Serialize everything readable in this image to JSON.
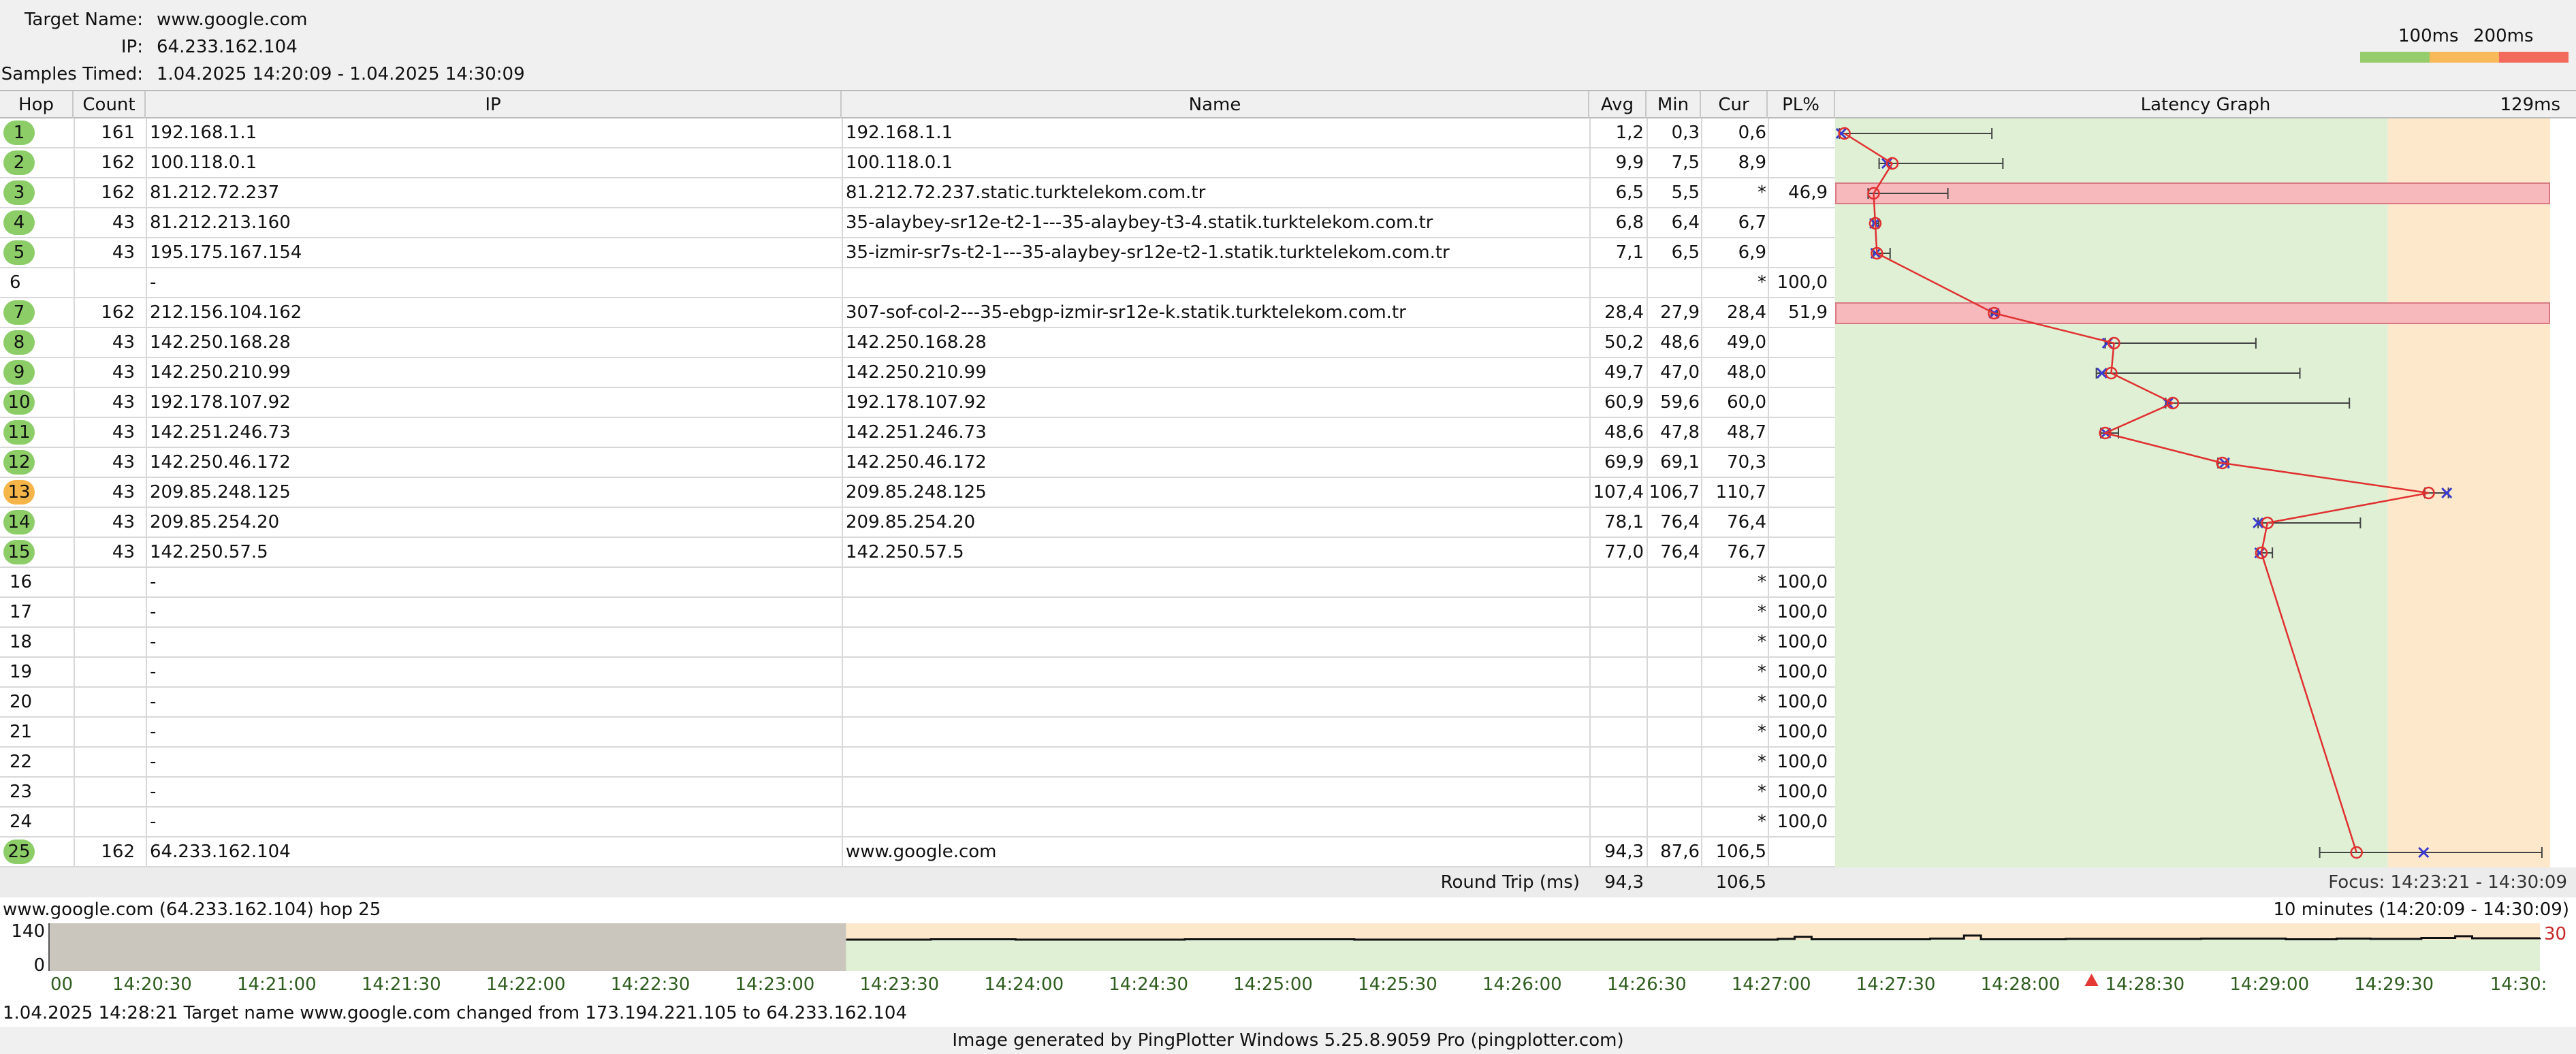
{
  "header": {
    "target_label": "Target Name:",
    "target_value": "www.google.com",
    "ip_label": "IP:",
    "ip_value": "64.233.162.104",
    "samples_label": "Samples Timed:",
    "samples_value": "1.04.2025 14:20:09 - 1.04.2025 14:30:09",
    "legend_100": "100ms",
    "legend_200": "200ms"
  },
  "colors": {
    "good": "#95cc6c",
    "warn": "#f7b95a",
    "bad": "#f16a5c",
    "graph_green": "#dff0d5",
    "graph_orange": "#fde8cb",
    "loss_fill": "#f8b9bd",
    "line": "#e03030",
    "marker": "#3a3ad0",
    "hop_green": "#8ccd68",
    "hop_orange": "#f5b549"
  },
  "columns": {
    "hop": "Hop",
    "count": "Count",
    "ip": "IP",
    "name": "Name",
    "avg": "Avg",
    "min": "Min",
    "cur": "Cur",
    "pl": "PL%",
    "graph": "Latency Graph",
    "graph_max": "129ms"
  },
  "hops": [
    {
      "hop": "1",
      "count": "161",
      "ip": "192.168.1.1",
      "name": "192.168.1.1",
      "avg": "1,2",
      "min": "0,3",
      "cur": "0,6",
      "pl": "",
      "status": "good",
      "avg_ms": 1.2,
      "min_ms": 0.3,
      "cur_ms": 0.6,
      "max_ms": 28
    },
    {
      "hop": "2",
      "count": "162",
      "ip": "100.118.0.1",
      "name": "100.118.0.1",
      "avg": "9,9",
      "min": "7,5",
      "cur": "8,9",
      "pl": "",
      "status": "good",
      "avg_ms": 9.9,
      "min_ms": 7.5,
      "cur_ms": 8.9,
      "max_ms": 30
    },
    {
      "hop": "3",
      "count": "162",
      "ip": "81.212.72.237",
      "name": "81.212.72.237.static.turktelekom.com.tr",
      "avg": "6,5",
      "min": "5,5",
      "cur": "*",
      "pl": "46,9",
      "status": "good",
      "avg_ms": 6.5,
      "min_ms": 5.5,
      "cur_ms": null,
      "max_ms": 20,
      "loss": true
    },
    {
      "hop": "4",
      "count": "43",
      "ip": "81.212.213.160",
      "name": "35-alaybey-sr12e-t2-1---35-alaybey-t3-4.statik.turktelekom.com.tr",
      "avg": "6,8",
      "min": "6,4",
      "cur": "6,7",
      "pl": "",
      "status": "good",
      "avg_ms": 6.8,
      "min_ms": 6.4,
      "cur_ms": 6.7,
      "max_ms": 7.4
    },
    {
      "hop": "5",
      "count": "43",
      "ip": "195.175.167.154",
      "name": "35-izmir-sr7s-t2-1---35-alaybey-sr12e-t2-1.statik.turktelekom.com.tr",
      "avg": "7,1",
      "min": "6,5",
      "cur": "6,9",
      "pl": "",
      "status": "good",
      "avg_ms": 7.1,
      "min_ms": 6.5,
      "cur_ms": 6.9,
      "max_ms": 9.5
    },
    {
      "hop": "6",
      "count": "",
      "ip": "-",
      "name": "",
      "avg": "",
      "min": "",
      "cur": "*",
      "pl": "100,0",
      "status": "none"
    },
    {
      "hop": "7",
      "count": "162",
      "ip": "212.156.104.162",
      "name": "307-sof-col-2---35-ebgp-izmir-sr12e-k.statik.turktelekom.com.tr",
      "avg": "28,4",
      "min": "27,9",
      "cur": "28,4",
      "pl": "51,9",
      "status": "good",
      "avg_ms": 28.4,
      "min_ms": 27.9,
      "cur_ms": 28.4,
      "max_ms": 29,
      "loss": true
    },
    {
      "hop": "8",
      "count": "43",
      "ip": "142.250.168.28",
      "name": "142.250.168.28",
      "avg": "50,2",
      "min": "48,6",
      "cur": "49,0",
      "pl": "",
      "status": "good",
      "avg_ms": 50.2,
      "min_ms": 48.6,
      "cur_ms": 49.0,
      "max_ms": 76
    },
    {
      "hop": "9",
      "count": "43",
      "ip": "142.250.210.99",
      "name": "142.250.210.99",
      "avg": "49,7",
      "min": "47,0",
      "cur": "48,0",
      "pl": "",
      "status": "good",
      "avg_ms": 49.7,
      "min_ms": 47.0,
      "cur_ms": 48.0,
      "max_ms": 84
    },
    {
      "hop": "10",
      "count": "43",
      "ip": "192.178.107.92",
      "name": "192.178.107.92",
      "avg": "60,9",
      "min": "59,6",
      "cur": "60,0",
      "pl": "",
      "status": "good",
      "avg_ms": 60.9,
      "min_ms": 59.6,
      "cur_ms": 60.0,
      "max_ms": 93
    },
    {
      "hop": "11",
      "count": "43",
      "ip": "142.251.246.73",
      "name": "142.251.246.73",
      "avg": "48,6",
      "min": "47,8",
      "cur": "48,7",
      "pl": "",
      "status": "good",
      "avg_ms": 48.6,
      "min_ms": 47.8,
      "cur_ms": 48.7,
      "max_ms": 51
    },
    {
      "hop": "12",
      "count": "43",
      "ip": "142.250.46.172",
      "name": "142.250.46.172",
      "avg": "69,9",
      "min": "69,1",
      "cur": "70,3",
      "pl": "",
      "status": "good",
      "avg_ms": 69.9,
      "min_ms": 69.1,
      "cur_ms": 70.3,
      "max_ms": 71
    },
    {
      "hop": "13",
      "count": "43",
      "ip": "209.85.248.125",
      "name": "209.85.248.125",
      "avg": "107,4",
      "min": "106,7",
      "cur": "110,7",
      "pl": "",
      "status": "warn",
      "avg_ms": 107.4,
      "min_ms": 106.7,
      "cur_ms": 110.7,
      "max_ms": 111
    },
    {
      "hop": "14",
      "count": "43",
      "ip": "209.85.254.20",
      "name": "209.85.254.20",
      "avg": "78,1",
      "min": "76,4",
      "cur": "76,4",
      "pl": "",
      "status": "good",
      "avg_ms": 78.1,
      "min_ms": 76.4,
      "cur_ms": 76.4,
      "max_ms": 95
    },
    {
      "hop": "15",
      "count": "43",
      "ip": "142.250.57.5",
      "name": "142.250.57.5",
      "avg": "77,0",
      "min": "76,4",
      "cur": "76,7",
      "pl": "",
      "status": "good",
      "avg_ms": 77.0,
      "min_ms": 76.4,
      "cur_ms": 76.7,
      "max_ms": 79
    },
    {
      "hop": "16",
      "count": "",
      "ip": "-",
      "name": "",
      "avg": "",
      "min": "",
      "cur": "*",
      "pl": "100,0",
      "status": "none"
    },
    {
      "hop": "17",
      "count": "",
      "ip": "-",
      "name": "",
      "avg": "",
      "min": "",
      "cur": "*",
      "pl": "100,0",
      "status": "none"
    },
    {
      "hop": "18",
      "count": "",
      "ip": "-",
      "name": "",
      "avg": "",
      "min": "",
      "cur": "*",
      "pl": "100,0",
      "status": "none"
    },
    {
      "hop": "19",
      "count": "",
      "ip": "-",
      "name": "",
      "avg": "",
      "min": "",
      "cur": "*",
      "pl": "100,0",
      "status": "none"
    },
    {
      "hop": "20",
      "count": "",
      "ip": "-",
      "name": "",
      "avg": "",
      "min": "",
      "cur": "*",
      "pl": "100,0",
      "status": "none"
    },
    {
      "hop": "21",
      "count": "",
      "ip": "-",
      "name": "",
      "avg": "",
      "min": "",
      "cur": "*",
      "pl": "100,0",
      "status": "none"
    },
    {
      "hop": "22",
      "count": "",
      "ip": "-",
      "name": "",
      "avg": "",
      "min": "",
      "cur": "*",
      "pl": "100,0",
      "status": "none"
    },
    {
      "hop": "23",
      "count": "",
      "ip": "-",
      "name": "",
      "avg": "",
      "min": "",
      "cur": "*",
      "pl": "100,0",
      "status": "none"
    },
    {
      "hop": "24",
      "count": "",
      "ip": "-",
      "name": "",
      "avg": "",
      "min": "",
      "cur": "*",
      "pl": "100,0",
      "status": "none"
    },
    {
      "hop": "25",
      "count": "162",
      "ip": "64.233.162.104",
      "name": "www.google.com",
      "avg": "94,3",
      "min": "87,6",
      "cur": "106,5",
      "pl": "",
      "status": "good",
      "avg_ms": 94.3,
      "min_ms": 87.6,
      "cur_ms": 106.5,
      "max_ms": 128
    }
  ],
  "round_trip": {
    "label": "Round Trip (ms)",
    "avg": "94,3",
    "cur": "106,5",
    "focus": "Focus: 14:23:21 - 14:30:09"
  },
  "graph_scale": {
    "max_ms": 129,
    "green_until_ms": 100,
    "orange_until_ms": 129
  },
  "timeline": {
    "title": "www.google.com (64.233.162.104) hop 25",
    "range": "10 minutes (14:20:09 - 14:30:09)",
    "y_max": "140",
    "y_min": "0",
    "right_value": "30",
    "ticks": [
      "00",
      "14:20:30",
      "14:21:00",
      "14:21:30",
      "14:22:00",
      "14:22:30",
      "14:23:00",
      "14:23:30",
      "14:24:00",
      "14:24:30",
      "14:25:00",
      "14:25:30",
      "14:26:00",
      "14:26:30",
      "14:27:00",
      "14:27:30",
      "14:28:00",
      "14:28:30",
      "14:29:00",
      "14:29:30",
      "14:30:"
    ],
    "focus_start_fraction": 0.32,
    "event_marker_fraction": 0.82
  },
  "event_text": "1.04.2025 14:28:21 Target name www.google.com changed from 173.194.221.105 to 64.233.162.104",
  "footer": "Image generated by PingPlotter Windows 5.25.8.9059 Pro (pingplotter.com)"
}
